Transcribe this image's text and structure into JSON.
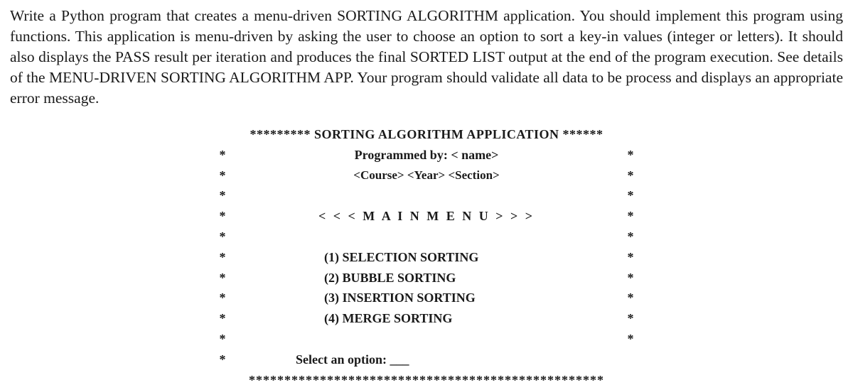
{
  "question": "Write a Python program that creates a menu-driven SORTING ALGORITHM application. You should implement this program using functions. This application is menu-driven by asking the user to choose an option to sort a key-in values (integer or letters).  It should also displays the PASS result per iteration and produces the final SORTED LIST output at the end of the program execution. See details of the MENU-DRIVEN SORTING ALGORITHM APP. Your program should validate all data to be process and displays an appropriate error message.",
  "menu": {
    "top_border": "********* SORTING ALGORITHM APPLICATION ******",
    "programmed_by": "Programmed by: < name>",
    "course_line": "<Course> <Year> <Section>",
    "main_menu_label": "< < <  M  A   I   N       M  E  N   U  >  >  >",
    "options": [
      "(1)  SELECTION SORTING",
      "(2)  BUBBLE SORTING",
      "(3)  INSERTION SORTING",
      "(4)  MERGE SORTING"
    ],
    "prompt": "Select  an option: ___",
    "bottom_border": "**************************************************",
    "star": "*"
  }
}
